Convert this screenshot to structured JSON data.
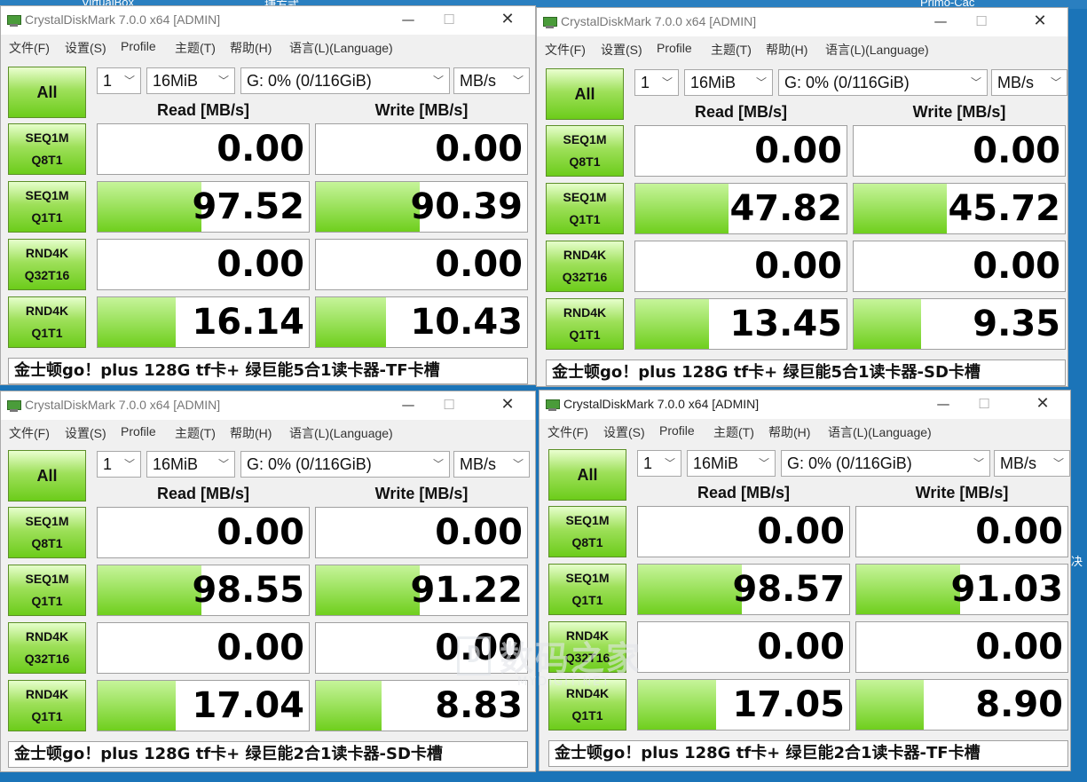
{
  "desktop": {
    "labels": [
      "VirtualBox",
      "捷方式",
      "Primo-Cac"
    ],
    "right_char": "决"
  },
  "common": {
    "title": "CrystalDiskMark 7.0.0 x64 [ADMIN]",
    "minimize_glyph": "—",
    "maximize_glyph": "☐",
    "close_glyph": "✕",
    "menu": [
      "文件(F)",
      "设置(S)",
      "Profile",
      "主题(T)",
      "帮助(H)",
      "语言(L)(Language)"
    ],
    "all_label": "All",
    "count": "1",
    "size": "16MiB",
    "drive": "G: 0% (0/116GiB)",
    "unit": "MB/s",
    "chevron": "﹀",
    "read_header": "Read [MB/s]",
    "write_header": "Write [MB/s]",
    "tests": [
      {
        "l1": "SEQ1M",
        "l2": "Q8T1"
      },
      {
        "l1": "SEQ1M",
        "l2": "Q1T1"
      },
      {
        "l1": "RND4K",
        "l2": "Q32T16"
      },
      {
        "l1": "RND4K",
        "l2": "Q1T1"
      }
    ]
  },
  "windows": [
    {
      "active": false,
      "results": [
        {
          "read": "0.00",
          "write": "0.00",
          "read_fill": 0,
          "write_fill": 0
        },
        {
          "read": "97.52",
          "write": "90.39",
          "read_fill": 0.49,
          "write_fill": 0.49
        },
        {
          "read": "0.00",
          "write": "0.00",
          "read_fill": 0,
          "write_fill": 0
        },
        {
          "read": "16.14",
          "write": "10.43",
          "read_fill": 0.37,
          "write_fill": 0.33
        }
      ],
      "comment": "金士顿go！plus 128G tf卡+ 绿巨能5合1读卡器-TF卡槽"
    },
    {
      "active": false,
      "results": [
        {
          "read": "0.00",
          "write": "0.00",
          "read_fill": 0,
          "write_fill": 0
        },
        {
          "read": "47.82",
          "write": "45.72",
          "read_fill": 0.44,
          "write_fill": 0.44
        },
        {
          "read": "0.00",
          "write": "0.00",
          "read_fill": 0,
          "write_fill": 0
        },
        {
          "read": "13.45",
          "write": "9.35",
          "read_fill": 0.35,
          "write_fill": 0.32
        }
      ],
      "comment": "金士顿go！plus 128G tf卡+ 绿巨能5合1读卡器-SD卡槽"
    },
    {
      "active": false,
      "results": [
        {
          "read": "0.00",
          "write": "0.00",
          "read_fill": 0,
          "write_fill": 0
        },
        {
          "read": "98.55",
          "write": "91.22",
          "read_fill": 0.49,
          "write_fill": 0.49
        },
        {
          "read": "0.00",
          "write": "0.00",
          "read_fill": 0,
          "write_fill": 0
        },
        {
          "read": "17.04",
          "write": "8.83",
          "read_fill": 0.37,
          "write_fill": 0.31
        }
      ],
      "comment": "金士顿go！plus 128G tf卡+ 绿巨能2合1读卡器-SD卡槽"
    },
    {
      "active": true,
      "results": [
        {
          "read": "0.00",
          "write": "0.00",
          "read_fill": 0,
          "write_fill": 0
        },
        {
          "read": "98.57",
          "write": "91.03",
          "read_fill": 0.49,
          "write_fill": 0.49
        },
        {
          "read": "0.00",
          "write": "0.00",
          "read_fill": 0,
          "write_fill": 0
        },
        {
          "read": "17.05",
          "write": "8.90",
          "read_fill": 0.37,
          "write_fill": 0.32
        }
      ],
      "comment": "金士顿go！plus 128G tf卡+ 绿巨能2合1读卡器-TF卡槽"
    }
  ],
  "watermark": {
    "logo": "D",
    "cn": "数码之家",
    "en": "MYDIGIT.NET"
  }
}
